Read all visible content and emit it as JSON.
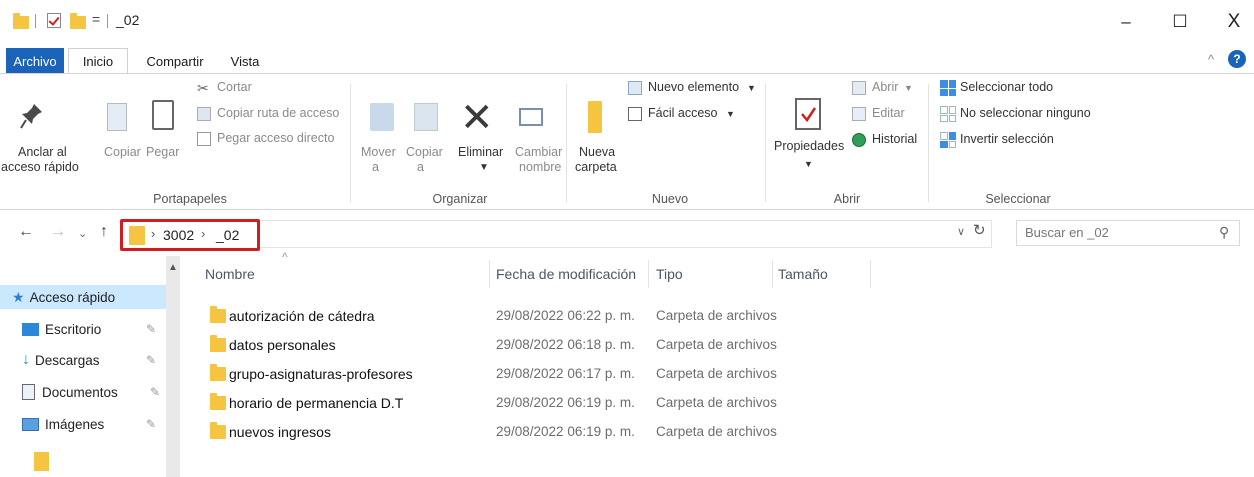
{
  "titlebar": {
    "qa_dropdown": "=",
    "title": "_02",
    "minimize": "–",
    "maximize": "☐",
    "close": "X",
    "collapse_ribbon": "^",
    "help": "?"
  },
  "tabs": [
    "Archivo",
    "Inicio",
    "Compartir",
    "Vista"
  ],
  "ribbon": {
    "portapapeles": {
      "label": "Portapapeles",
      "pin_line1": "Anclar al",
      "pin_line2": "acceso rápido",
      "copy": "Copiar",
      "paste": "Pegar",
      "cut": "Cortar",
      "copy_path": "Copiar ruta de acceso",
      "paste_shortcut": "Pegar acceso directo"
    },
    "organizar": {
      "label": "Organizar",
      "move_line1": "Mover",
      "move_line2": "a",
      "copy_line1": "Copiar",
      "copy_line2": "a",
      "delete": "Eliminar",
      "rename_line1": "Cambiar",
      "rename_line2": "nombre"
    },
    "nuevo": {
      "label": "Nuevo",
      "folder_line1": "Nueva",
      "folder_line2": "carpeta",
      "new_item": "Nuevo elemento",
      "easy_access": "Fácil acceso"
    },
    "abrir": {
      "label": "Abrir",
      "properties": "Propiedades",
      "open": "Abrir",
      "edit": "Editar",
      "history": "Historial"
    },
    "seleccionar": {
      "label": "Seleccionar",
      "select_all": "Seleccionar todo",
      "select_none": "No seleccionar ninguno",
      "invert": "Invertir selección"
    }
  },
  "address": {
    "segments": [
      "3002",
      "_02"
    ],
    "search_placeholder": "Buscar en _02"
  },
  "nav": {
    "items": [
      {
        "label": "Acceso rápido"
      },
      {
        "label": "Escritorio"
      },
      {
        "label": "Descargas"
      },
      {
        "label": "Documentos"
      },
      {
        "label": "Imágenes"
      }
    ]
  },
  "columns": [
    "Nombre",
    "Fecha de modificación",
    "Tipo",
    "Tamaño"
  ],
  "files": [
    {
      "name": "autorización de cátedra",
      "date": "29/08/2022 06:22 p. m.",
      "type": "Carpeta de archivos"
    },
    {
      "name": "datos personales",
      "date": "29/08/2022 06:18 p. m.",
      "type": "Carpeta de archivos"
    },
    {
      "name": "grupo-asignaturas-profesores",
      "date": "29/08/2022 06:17 p. m.",
      "type": "Carpeta de archivos"
    },
    {
      "name": "horario de permanencia D.T",
      "date": "29/08/2022 06:19 p. m.",
      "type": "Carpeta de archivos"
    },
    {
      "name": "nuevos ingresos",
      "date": "29/08/2022 06:19 p. m.",
      "type": "Carpeta de archivos"
    }
  ],
  "colors": {
    "accent": "#1a63b8",
    "folder": "#f5c542",
    "highlight": "#d11d1d",
    "selected_nav": "#cce8ff"
  }
}
